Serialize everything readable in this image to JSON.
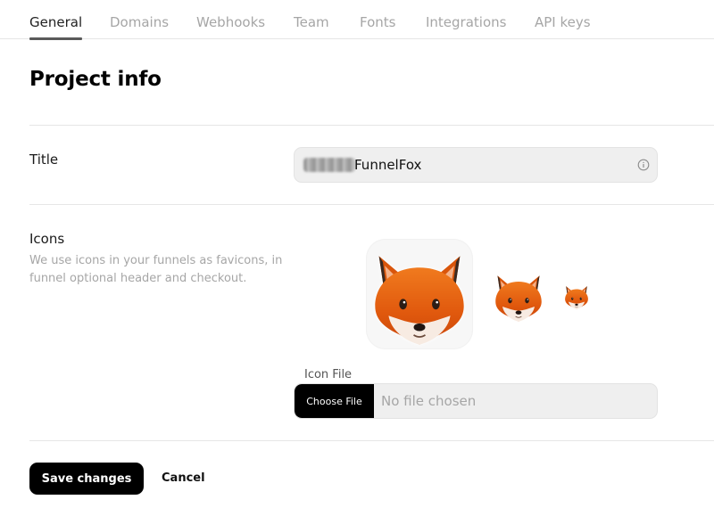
{
  "tabs": [
    {
      "label": "General",
      "active": true
    },
    {
      "label": "Domains",
      "active": false
    },
    {
      "label": "Webhooks",
      "active": false
    },
    {
      "label": "Team",
      "active": false
    },
    {
      "label": "Fonts",
      "active": false
    },
    {
      "label": "Integrations",
      "active": false
    },
    {
      "label": "API keys",
      "active": false
    }
  ],
  "page": {
    "title": "Project info"
  },
  "title_field": {
    "label": "Title",
    "value": "FunnelFox",
    "icon": "info-icon"
  },
  "icons_section": {
    "label": "Icons",
    "help": "We use icons in your funnels as favicons, in funnel optional header and checkout.",
    "preview_icon": "fox-face-icon"
  },
  "icon_file": {
    "label": "Icon File",
    "button": "Choose File",
    "status": "No file chosen"
  },
  "actions": {
    "save": "Save changes",
    "cancel": "Cancel"
  },
  "colors": {
    "accent": "#000000",
    "muted_text": "#a6a6a6",
    "field_bg": "#efefef",
    "fox_orange": "#e8650f"
  }
}
